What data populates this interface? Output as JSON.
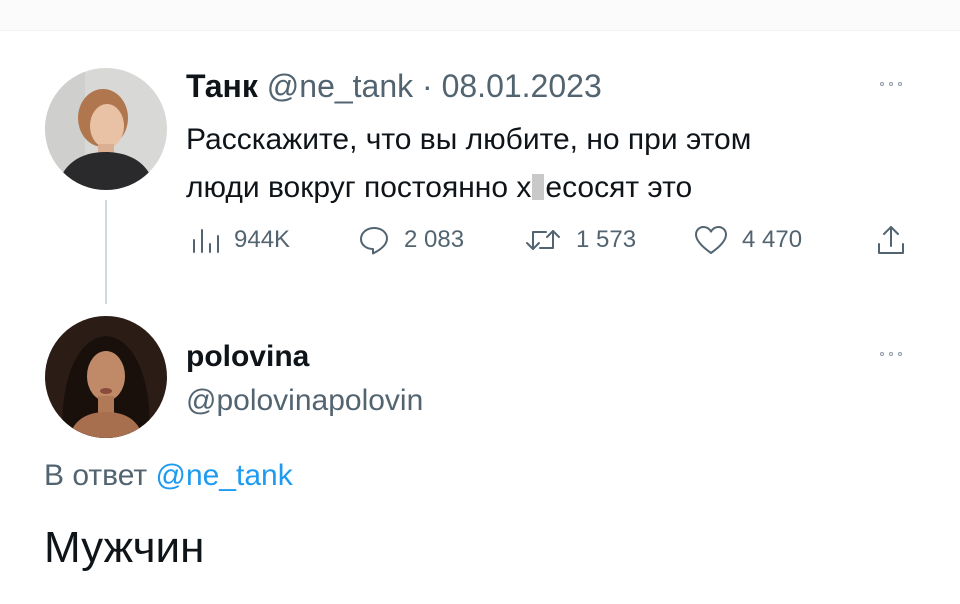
{
  "tweet1": {
    "display_name": "Танк",
    "handle": "@ne_tank",
    "separator": " · ",
    "date": "08.01.2023",
    "text_line1": "Расскажите, что вы любите, но при этом",
    "text_line2_before": "люди вокруг постоянно х",
    "text_line2_after": "есосят это",
    "stats": {
      "views": "944K",
      "replies": "2 083",
      "retweets": "1 573",
      "likes": "4 470"
    },
    "icons": [
      "avatar",
      "more-icon",
      "views-icon",
      "reply-icon",
      "retweet-icon",
      "like-icon",
      "share-icon"
    ]
  },
  "tweet2": {
    "display_name": "polovina",
    "handle": "@polovinapolovin",
    "reply_prefix": "В ответ ",
    "reply_to": "@ne_tank",
    "text": "Мужчин",
    "icons": [
      "avatar",
      "more-icon"
    ]
  },
  "colors": {
    "text": "#0f1419",
    "muted": "#536471",
    "link": "#1d9bf0",
    "thread_line": "#cfd9de"
  }
}
